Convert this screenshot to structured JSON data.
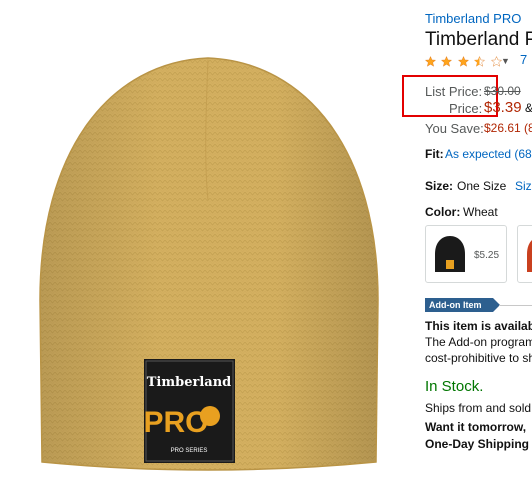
{
  "product": {
    "brand_link": "Timberland PRO",
    "title": "Timberland P",
    "rating_stars": 3.5,
    "review_count": "7"
  },
  "pricing": {
    "list_price_label": "List Price:",
    "list_price_value": "$30.00",
    "price_label": "Price:",
    "price_value": "$3.39",
    "price_suffix": "&",
    "you_save_label": "You Save:",
    "you_save_value": "$26.61 (8"
  },
  "fit": {
    "label": "Fit:",
    "value": "As expected (68"
  },
  "size": {
    "label": "Size:",
    "value": "One Size",
    "chart_link": "Size"
  },
  "color": {
    "label": "Color:",
    "value": "Wheat",
    "swatches": [
      {
        "name": "black",
        "price": "$5.25",
        "color": "#1a1a1a"
      },
      {
        "name": "red",
        "price": "",
        "color": "#c9401f"
      }
    ]
  },
  "addon": {
    "badge": "Add-on Item",
    "line1": "This item is availab",
    "line2": "The Add-on program",
    "line3": "cost-prohibitive to sh"
  },
  "availability": {
    "stock": "In Stock.",
    "ships": "Ships from and sold",
    "want": "Want it tomorrow,",
    "oneday": "One-Day Shipping a"
  },
  "hat_label": {
    "line1": "Timberland",
    "line2": "PRO",
    "line3": "PRO SERIES"
  },
  "colors": {
    "price_red": "#B12704",
    "link_blue": "#0066c0",
    "stock_green": "#007600",
    "star_orange": "#FFA41C",
    "highlight_red": "#e30000",
    "hat_wheat": "#d4b060"
  }
}
